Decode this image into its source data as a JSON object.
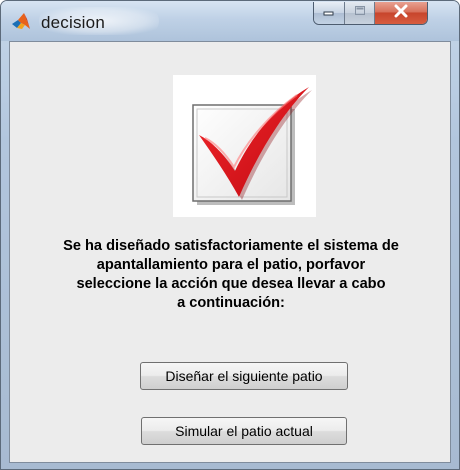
{
  "window": {
    "title": "decision",
    "icon": "matlab-logo-icon"
  },
  "caption_buttons": {
    "minimize": "minimize-icon",
    "maximize": "maximize-icon",
    "close": "close-icon"
  },
  "content": {
    "image": "red-checkmark-icon",
    "message": "Se ha diseñado satisfactoriamente el sistema de\napantallamiento para el patio, porfavor\nseleccione la acción que desea llevar a cabo\na continuación:",
    "buttons": {
      "design_next": "Diseñar el siguiente patio",
      "simulate_current": "Simular el patio actual"
    }
  },
  "colors": {
    "check_red": "#e0141c",
    "close_button": "#c7452c",
    "client_background": "#ececec"
  }
}
